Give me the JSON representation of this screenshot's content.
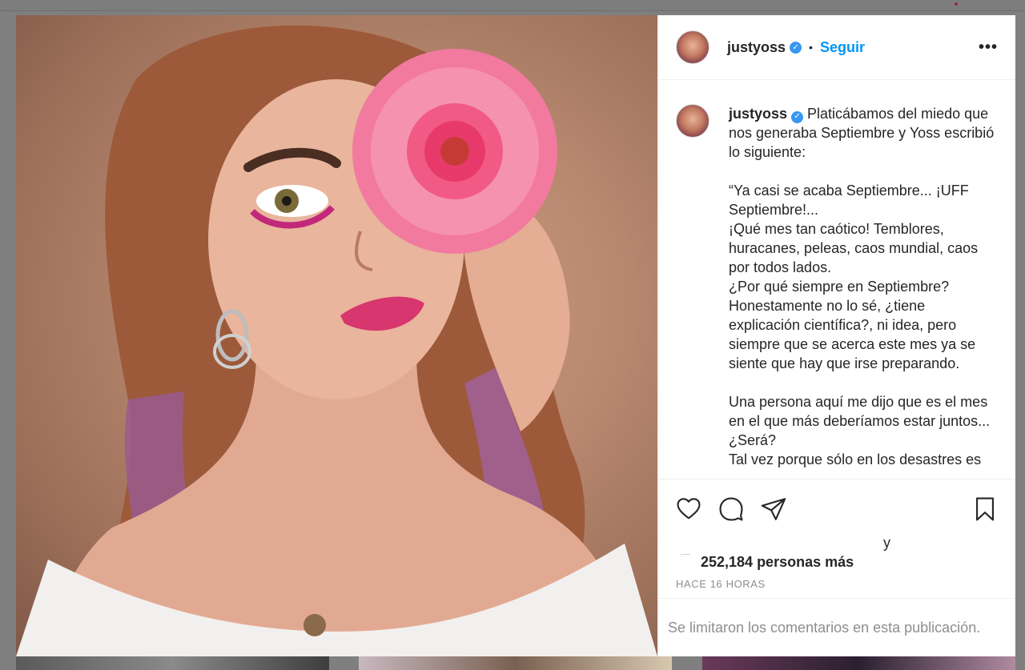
{
  "post": {
    "username": "justyoss",
    "verified_mark": "✓",
    "separator": "•",
    "follow_label": "Seguir",
    "more_label": "•••",
    "caption_username": "justyoss",
    "caption_body": " Platicábamos del miedo que nos generaba Septiembre y Yoss escribió lo siguiente:\n\n“Ya casi se acaba Septiembre... ¡UFF Septiembre!...\n¡Qué mes tan caótico! Temblores, huracanes, peleas, caos mundial, caos por todos lados.\n¿Por qué siempre en Septiembre? Honestamente no lo sé, ¿tiene explicación científica?, ni idea, pero siempre que se acerca este mes ya se siente que hay que irse preparando.\n\nUna persona aquí me dijo que es el mes en el que más deberíamos estar juntos... ¿Será?\nTal vez porque sólo en los desastres es",
    "likes_connector": "y",
    "likes_text": "252,184 personas más",
    "timestamp": "HACE 16 HORAS",
    "comments_limited": "Se limitaron los comentarios en esta publicación."
  },
  "icons": {
    "like": "heart-icon",
    "comment": "comment-bubble-icon",
    "share": "paper-plane-icon",
    "save": "bookmark-icon"
  },
  "colors": {
    "link_blue": "#0095f6",
    "verified_blue": "#3897f0",
    "muted_text": "#8e8e8e",
    "backdrop": "#7f7f7f"
  }
}
